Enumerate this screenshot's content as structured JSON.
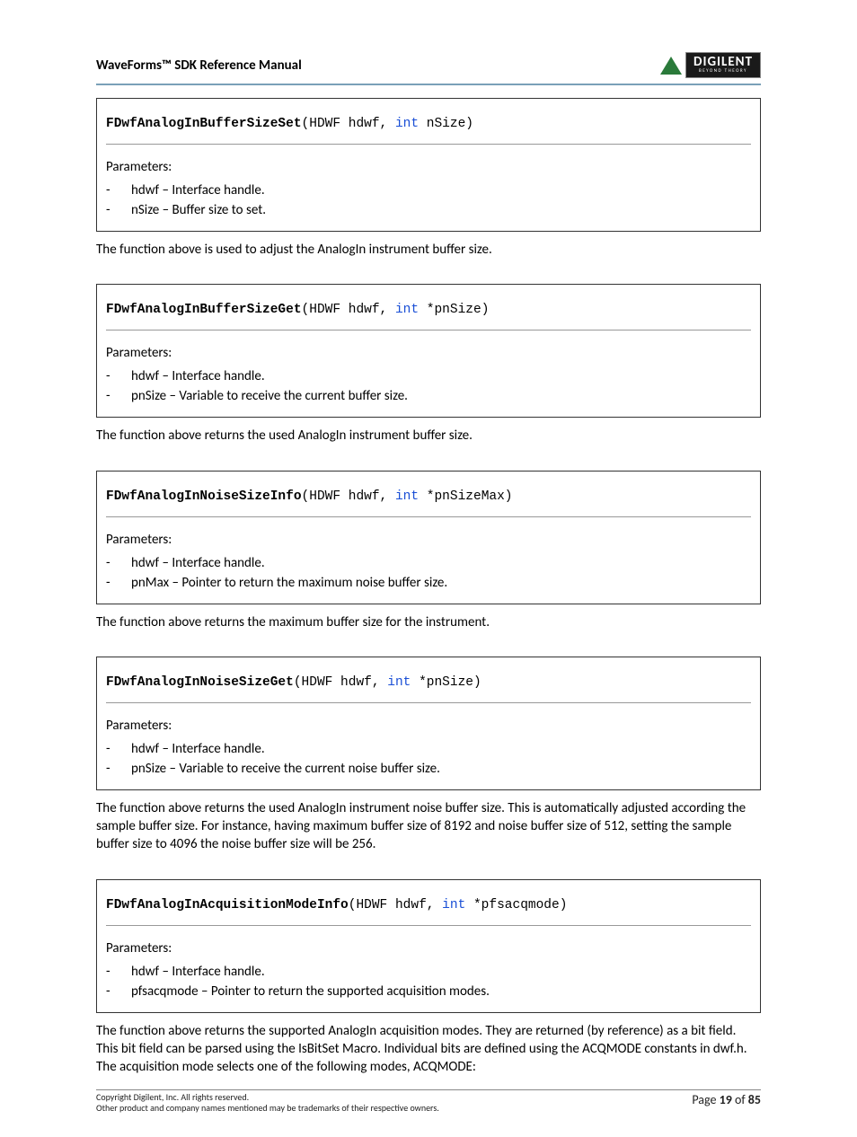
{
  "header": {
    "title": "WaveForms™ SDK Reference Manual",
    "logo": {
      "brand": "DIGILENT",
      "tagline": "BEYOND THEORY"
    }
  },
  "functions": [
    {
      "name": "FDwfAnalogInBufferSizeSet",
      "sig_prefix": "(HDWF hdwf, ",
      "sig_kw": "int",
      "sig_suffix": " nSize)",
      "params_label": "Parameters:",
      "params": [
        "hdwf – Interface handle.",
        "nSize – Buffer size to set."
      ],
      "desc": "The function above is used to adjust the AnalogIn instrument buffer size."
    },
    {
      "name": "FDwfAnalogInBufferSizeGet",
      "sig_prefix": "(HDWF hdwf, ",
      "sig_kw": "int",
      "sig_suffix": " *pnSize)",
      "params_label": "Parameters:",
      "params": [
        "hdwf – Interface handle.",
        "pnSize – Variable to receive the current buffer size."
      ],
      "desc": "The function above returns the used AnalogIn instrument buffer size."
    },
    {
      "name": "FDwfAnalogInNoiseSizeInfo",
      "sig_prefix": "(HDWF hdwf, ",
      "sig_kw": "int",
      "sig_suffix": " *pnSizeMax)",
      "params_label": "Parameters:",
      "params": [
        "hdwf – Interface handle.",
        "pnMax – Pointer to return the maximum noise buffer size."
      ],
      "desc": "The function above returns the maximum buffer size for the instrument."
    },
    {
      "name": "FDwfAnalogInNoiseSizeGet",
      "sig_prefix": "(HDWF hdwf, ",
      "sig_kw": "int",
      "sig_suffix": " *pnSize)",
      "params_label": "Parameters:",
      "params": [
        "hdwf – Interface handle.",
        "pnSize – Variable to receive the current noise buffer size."
      ],
      "desc": "The function above returns the used AnalogIn instrument noise buffer size. This is automatically adjusted according the sample buffer size. For instance, having maximum buffer size of 8192 and noise buffer size of 512, setting the sample buffer size to 4096 the noise buffer size will be 256."
    },
    {
      "name": "FDwfAnalogInAcquisitionModeInfo",
      "sig_prefix": "(HDWF hdwf, ",
      "sig_kw": "int",
      "sig_suffix": " *pfsacqmode)",
      "params_label": "Parameters:",
      "params": [
        "hdwf – Interface handle.",
        "pfsacqmode – Pointer to return the supported acquisition modes."
      ],
      "desc": "The function above returns the supported AnalogIn acquisition modes. They are returned (by reference) as a bit field. This bit field can be parsed using the IsBitSet Macro. Individual bits are defined using the ACQMODE constants in dwf.h. The acquisition mode selects one of the following modes, ACQMODE:"
    }
  ],
  "footer": {
    "copyright": "Copyright Digilent, Inc. All rights reserved.",
    "trademark": "Other product and company names mentioned may be trademarks of their respective owners.",
    "page_label": "Page ",
    "page_num": "19",
    "page_of": " of ",
    "page_total": "85"
  }
}
